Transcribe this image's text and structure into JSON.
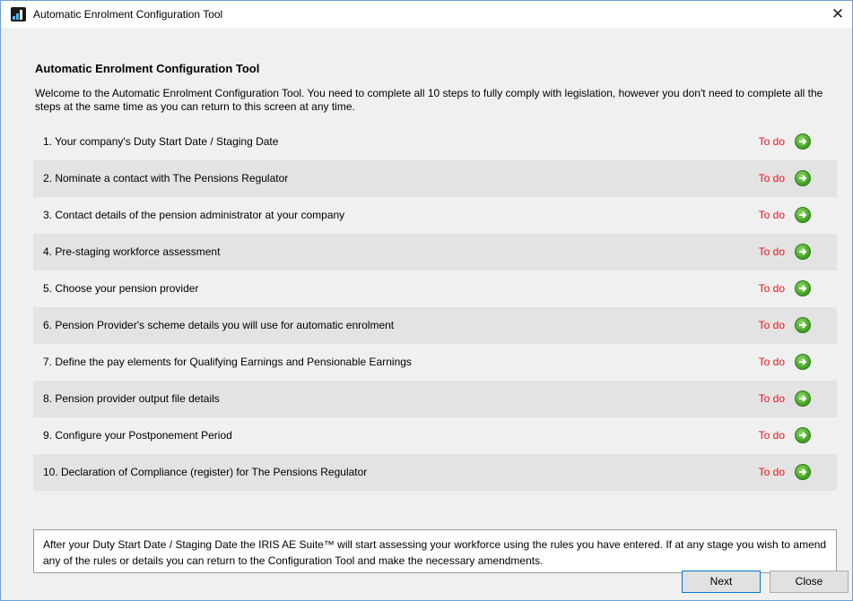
{
  "window": {
    "title": "Automatic Enrolment Configuration Tool"
  },
  "header": {
    "title": "Automatic Enrolment Configuration Tool",
    "intro": "Welcome to the Automatic Enrolment Configuration Tool. You need to complete all 10 steps to fully comply with legislation, however you don't need to complete all the steps at the same time as you can return to this screen at any time."
  },
  "steps": [
    {
      "label": "1. Your company's Duty Start Date / Staging Date",
      "status": "To do"
    },
    {
      "label": "2. Nominate a contact with The Pensions Regulator",
      "status": "To do"
    },
    {
      "label": "3. Contact details of the pension administrator at your company",
      "status": "To do"
    },
    {
      "label": "4. Pre-staging workforce assessment",
      "status": "To do"
    },
    {
      "label": "5. Choose your pension provider",
      "status": "To do"
    },
    {
      "label": "6. Pension Provider's scheme details you will use for automatic enrolment",
      "status": "To do"
    },
    {
      "label": "7. Define the pay elements for Qualifying Earnings and Pensionable Earnings",
      "status": "To do"
    },
    {
      "label": "8. Pension provider output file details",
      "status": "To do"
    },
    {
      "label": "9. Configure your Postponement Period",
      "status": "To do"
    },
    {
      "label": "10. Declaration of Compliance (register) for The Pensions Regulator",
      "status": "To do"
    }
  ],
  "note": "After your Duty Start Date / Staging Date the IRIS AE Suite™ will start assessing your workforce using the rules you have entered. If at any stage you wish to amend any of the rules or details you can return to the Configuration Tool and make the necessary amendments.",
  "buttons": {
    "next": "Next",
    "close": "Close"
  },
  "colors": {
    "todo": "#e8141e",
    "arrow": "#3e9e1f",
    "row_shade": "#e3e3e3"
  }
}
